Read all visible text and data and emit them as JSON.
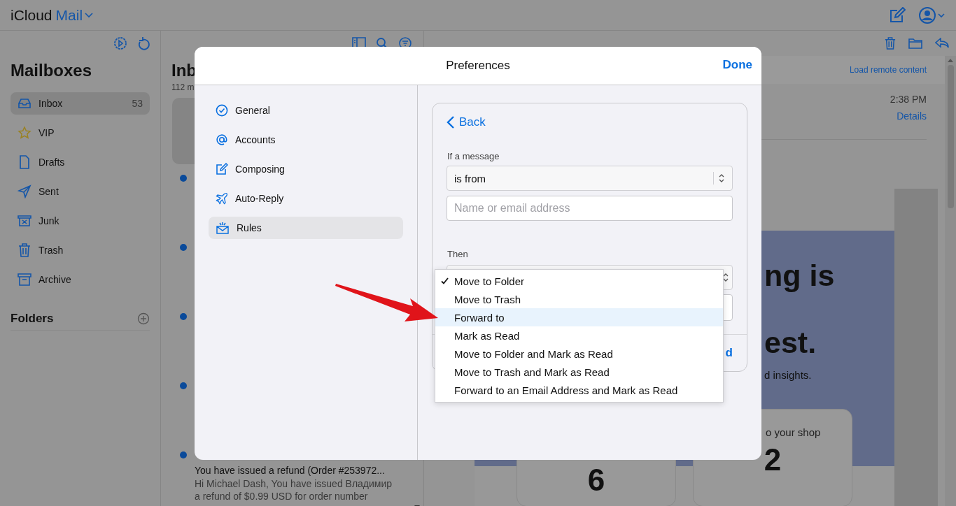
{
  "app": {
    "brand": "iCloud",
    "product": "Mail"
  },
  "sidebar": {
    "title": "Mailboxes",
    "mailboxes": [
      {
        "label": "Inbox",
        "count": "53",
        "selected": true
      },
      {
        "label": "VIP",
        "selected": false
      },
      {
        "label": "Drafts",
        "selected": false
      },
      {
        "label": "Sent",
        "selected": false
      },
      {
        "label": "Junk",
        "selected": false
      },
      {
        "label": "Trash",
        "selected": false
      },
      {
        "label": "Archive",
        "selected": false
      }
    ],
    "folders_title": "Folders"
  },
  "message_list": {
    "title": "Inb",
    "subtitle": "112 m",
    "messages": [
      {
        "selected": true,
        "unread": false
      },
      {
        "selected": false,
        "unread": true
      },
      {
        "selected": false,
        "unread": true
      },
      {
        "selected": false,
        "unread": true
      },
      {
        "selected": false,
        "unread": true
      },
      {
        "selected": false,
        "unread": true,
        "subject": "You have issued a refund (Order #253972...",
        "preview": "Hi Michael Dash, You have issued Владимир a refund of $0.99 USD for order number"
      }
    ]
  },
  "reader": {
    "load_remote": "Load remote content",
    "time": "2:38 PM",
    "details": "Details",
    "headline_1": "ng is",
    "headline_2": "est.",
    "body": "d insights.",
    "cards": [
      {
        "value": "6"
      },
      {
        "label": "o your shop",
        "value": "2"
      }
    ]
  },
  "preferences": {
    "title": "Preferences",
    "done": "Done",
    "sections": [
      {
        "label": "General",
        "selected": false
      },
      {
        "label": "Accounts",
        "selected": false
      },
      {
        "label": "Composing",
        "selected": false
      },
      {
        "label": "Auto-Reply",
        "selected": false
      },
      {
        "label": "Rules",
        "selected": true
      }
    ],
    "rule": {
      "back": "Back",
      "condition_label": "If a message",
      "condition": "is from",
      "address_placeholder": "Name or email address",
      "action_label": "Then",
      "add": "d",
      "action_menu": [
        {
          "label": "Move to Folder",
          "checked": true,
          "highlighted": false
        },
        {
          "label": "Move to Trash",
          "checked": false,
          "highlighted": false
        },
        {
          "label": "Forward to",
          "checked": false,
          "highlighted": true
        },
        {
          "label": "Mark as Read",
          "checked": false,
          "highlighted": false
        },
        {
          "label": "Move to Folder and Mark as Read",
          "checked": false,
          "highlighted": false
        },
        {
          "label": "Move to Trash and Mark as Read",
          "checked": false,
          "highlighted": false
        },
        {
          "label": "Forward to an Email Address and Mark as Read",
          "checked": false,
          "highlighted": false
        }
      ]
    }
  }
}
